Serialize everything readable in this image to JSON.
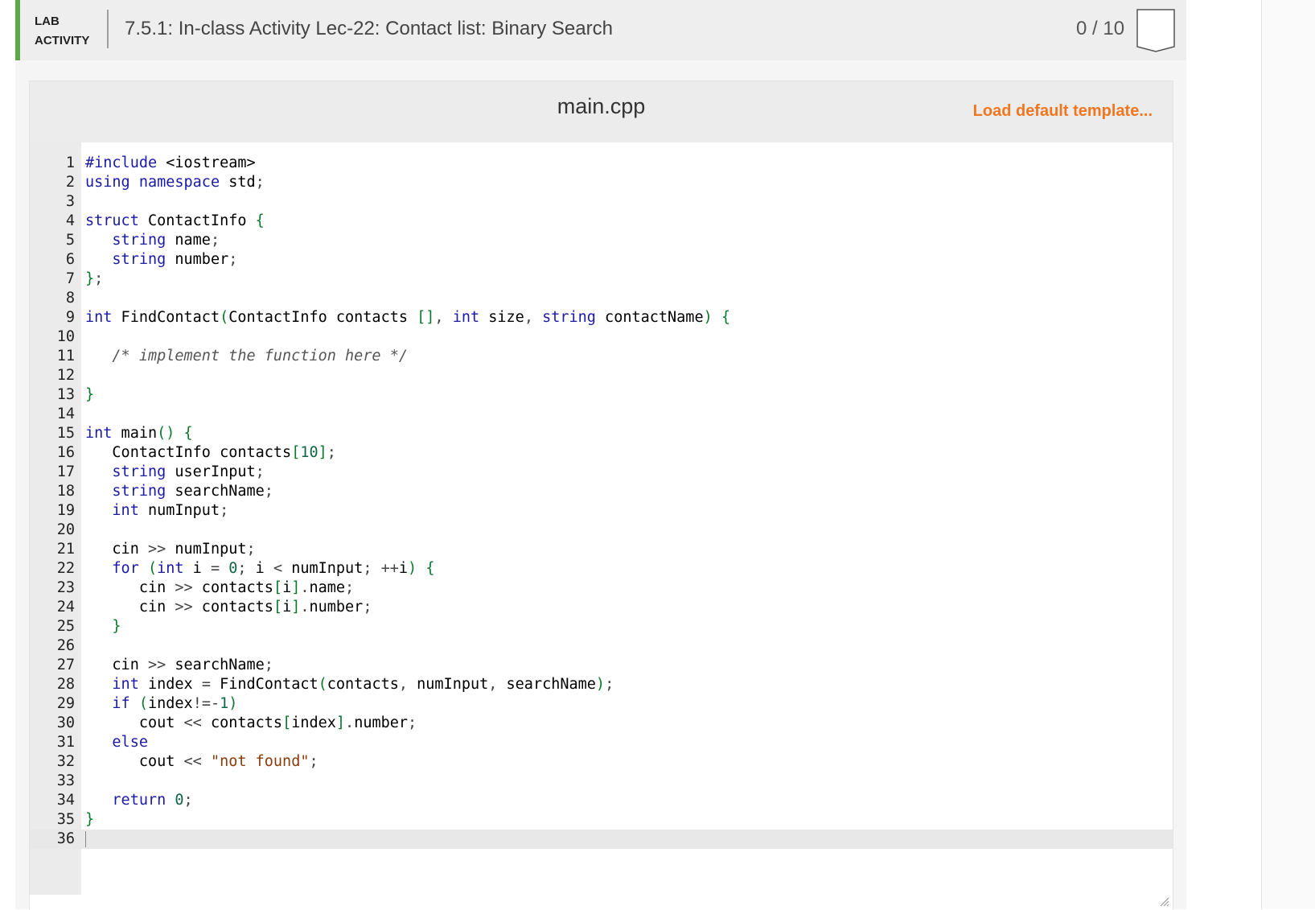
{
  "header": {
    "type_line1": "LAB",
    "type_line2": "ACTIVITY",
    "title": "7.5.1: In-class Activity Lec-22: Contact list: Binary Search",
    "score": "0 / 10",
    "accent_color": "#5aa846"
  },
  "editor": {
    "file_name": "main.cpp",
    "load_template_label": "Load default template...",
    "load_template_color": "#f0771f",
    "active_line": 36,
    "lines": [
      {
        "n": "1",
        "text": "#include <iostream>"
      },
      {
        "n": "2",
        "text": "using namespace std;"
      },
      {
        "n": "3",
        "text": ""
      },
      {
        "n": "4",
        "text": "struct ContactInfo {"
      },
      {
        "n": "5",
        "text": "   string name;"
      },
      {
        "n": "6",
        "text": "   string number;"
      },
      {
        "n": "7",
        "text": "};"
      },
      {
        "n": "8",
        "text": ""
      },
      {
        "n": "9",
        "text": "int FindContact(ContactInfo contacts [], int size, string contactName) {"
      },
      {
        "n": "10",
        "text": ""
      },
      {
        "n": "11",
        "text": "   /* implement the function here */"
      },
      {
        "n": "12",
        "text": ""
      },
      {
        "n": "13",
        "text": "}"
      },
      {
        "n": "14",
        "text": ""
      },
      {
        "n": "15",
        "text": "int main() {"
      },
      {
        "n": "16",
        "text": "   ContactInfo contacts[10];"
      },
      {
        "n": "17",
        "text": "   string userInput;"
      },
      {
        "n": "18",
        "text": "   string searchName;"
      },
      {
        "n": "19",
        "text": "   int numInput;"
      },
      {
        "n": "20",
        "text": ""
      },
      {
        "n": "21",
        "text": "   cin >> numInput;"
      },
      {
        "n": "22",
        "text": "   for (int i = 0; i < numInput; ++i) {"
      },
      {
        "n": "23",
        "text": "      cin >> contacts[i].name;"
      },
      {
        "n": "24",
        "text": "      cin >> contacts[i].number;"
      },
      {
        "n": "25",
        "text": "   }"
      },
      {
        "n": "26",
        "text": ""
      },
      {
        "n": "27",
        "text": "   cin >> searchName;"
      },
      {
        "n": "28",
        "text": "   int index = FindContact(contacts, numInput, searchName);"
      },
      {
        "n": "29",
        "text": "   if (index!=-1)"
      },
      {
        "n": "30",
        "text": "      cout << contacts[index].number;"
      },
      {
        "n": "31",
        "text": "   else"
      },
      {
        "n": "32",
        "text": "      cout << \"not found\";"
      },
      {
        "n": "33",
        "text": ""
      },
      {
        "n": "34",
        "text": "   return 0;"
      },
      {
        "n": "35",
        "text": "}"
      },
      {
        "n": "36",
        "text": ""
      }
    ]
  }
}
